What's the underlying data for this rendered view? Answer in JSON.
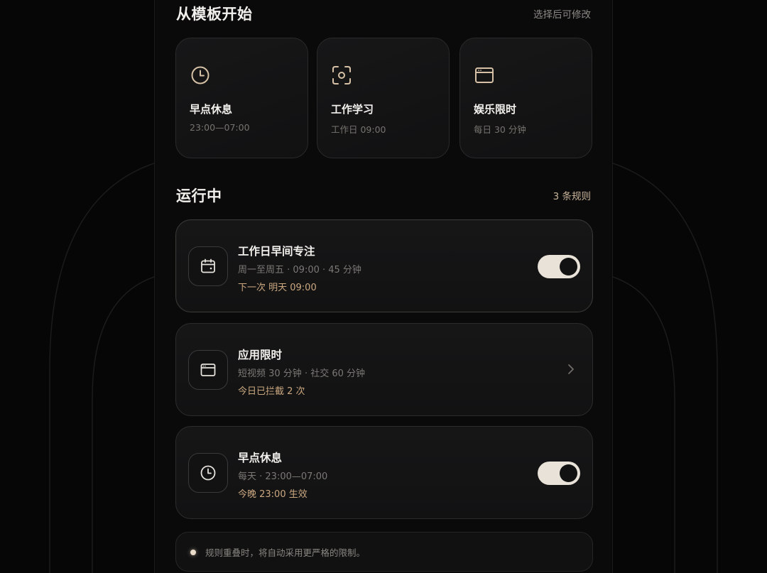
{
  "templates_section": {
    "title": "从模板开始",
    "hint": "选择后可修改",
    "items": [
      {
        "name": "早点休息",
        "sub": "23:00—07:00",
        "icon": "clock-icon"
      },
      {
        "name": "工作学习",
        "sub": "工作日 09:00",
        "icon": "focus-icon"
      },
      {
        "name": "娱乐限时",
        "sub": "每日 30 分钟",
        "icon": "app-window-icon"
      }
    ]
  },
  "running_section": {
    "title": "运行中",
    "count": "3 条规则",
    "rules": [
      {
        "title": "工作日早间专注",
        "desc": "周一至周五 · 09:00 · 45 分钟",
        "status": "下一次 明天 09:00",
        "icon": "calendar-icon",
        "control": "toggle",
        "enabled": true
      },
      {
        "title": "应用限时",
        "desc": "短视频 30 分钟 · 社交 60 分钟",
        "status": "今日已拦截 2 次",
        "icon": "app-window-icon",
        "control": "chevron"
      },
      {
        "title": "早点休息",
        "desc": "每天 · 23:00—07:00",
        "status": "今晚 23:00 生效",
        "icon": "clock-icon",
        "control": "toggle",
        "enabled": true
      }
    ]
  },
  "footer_note": "规则重叠时，将自动采用更严格的限制。",
  "colors": {
    "accent": "#cba880",
    "toggle_on": "#e8e2d8",
    "background": "#060606"
  }
}
